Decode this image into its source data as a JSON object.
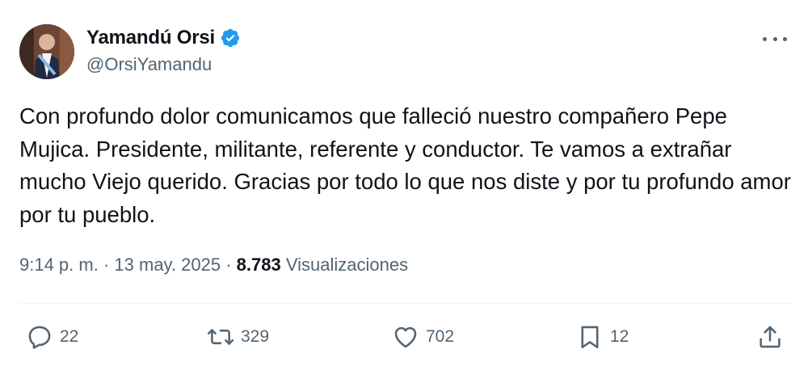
{
  "author": {
    "display_name": "Yamandú Orsi",
    "handle": "@OrsiYamandu",
    "verified_color": "#1d9bf0"
  },
  "tweet": {
    "text": "Con profundo dolor comunicamos que falleció nuestro compañero Pepe Mujica. Presidente, militante, referente y conductor. Te vamos a extrañar mucho Viejo querido. Gracias por todo lo que nos diste y por tu profundo amor por tu pueblo.",
    "time": "9:14 p. m.",
    "date": "13 may. 2025",
    "separator": " · ",
    "views_count": "8.783",
    "views_label": "Visualizaciones"
  },
  "actions": {
    "replies": "22",
    "retweets": "329",
    "likes": "702",
    "bookmarks": "12"
  },
  "icons": {
    "more": "more-horizontal-icon",
    "reply": "reply-icon",
    "retweet": "retweet-icon",
    "like": "heart-icon",
    "bookmark": "bookmark-icon",
    "share": "share-icon"
  }
}
